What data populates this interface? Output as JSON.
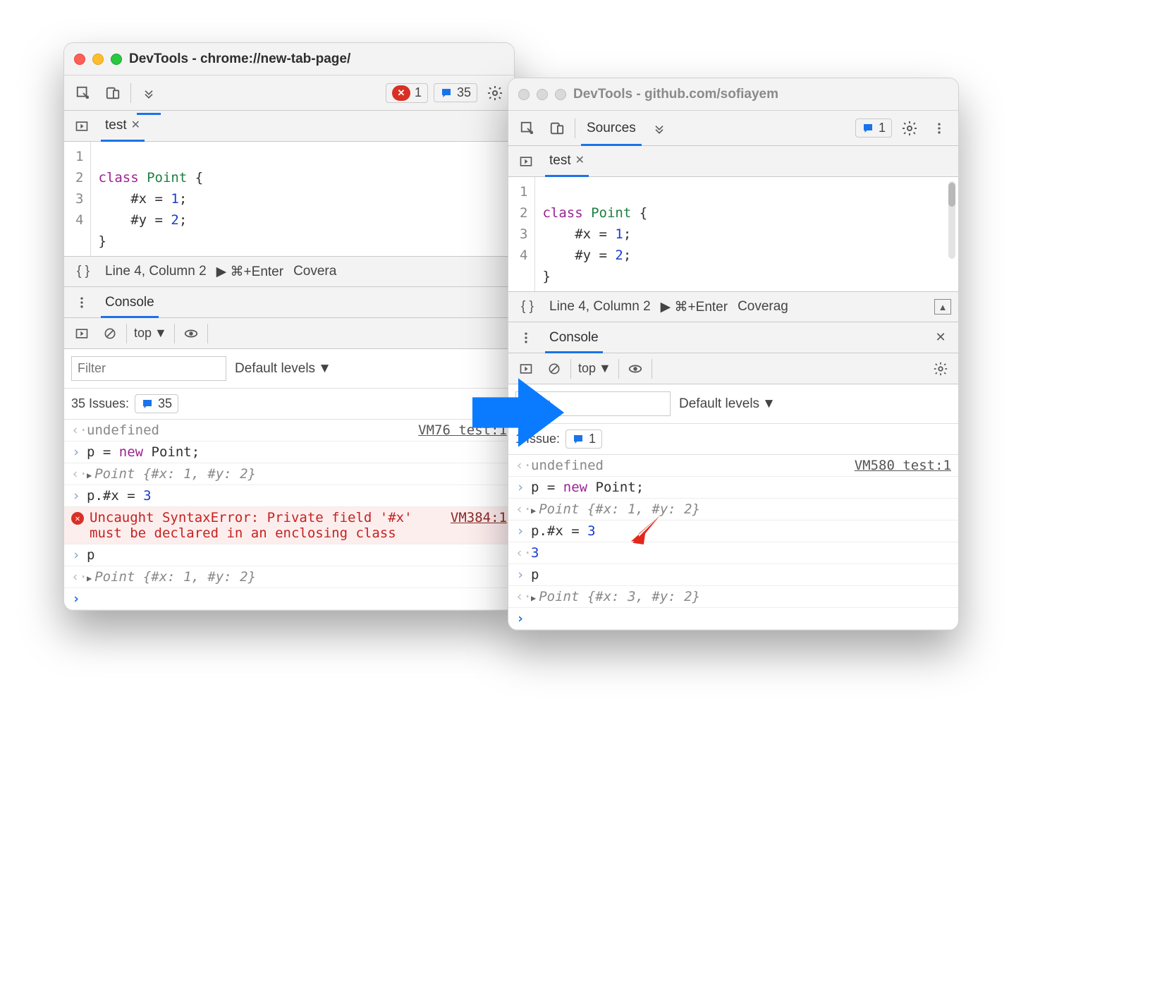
{
  "win1": {
    "title": "DevTools - chrome://new-tab-page/",
    "errors": "1",
    "issues": "35",
    "file_tab": "test",
    "code_lines": [
      "1",
      "2",
      "3",
      "4"
    ],
    "status_line": "Line 4, Column 2",
    "status_run": "⌘+Enter",
    "status_cov": "Covera",
    "drawer_tab": "Console",
    "context": "top",
    "filter_ph": "Filter",
    "levels": "Default levels",
    "issues_row_label": "35 Issues:",
    "issues_row_count": "35",
    "log": {
      "undef": "undefined",
      "undef_src": "VM76 test:1",
      "p_assign_pre": "p = ",
      "p_assign_kw": "new",
      "p_assign_post": " Point;",
      "p_obj": "Point {#x: 1, #y: 2}",
      "p_set": "p.#x = ",
      "p_set_val": "3",
      "err": "Uncaught SyntaxError: Private field '#x' must be declared in an enclosing class",
      "err_src": "VM384:1",
      "p_only": "p",
      "p_obj2": "Point {#x: 1, #y: 2}"
    }
  },
  "win2": {
    "title": "DevTools - github.com/sofiayem",
    "sources_tab": "Sources",
    "issues": "1",
    "file_tab": "test",
    "code_lines": [
      "1",
      "2",
      "3",
      "4"
    ],
    "status_line": "Line 4, Column 2",
    "status_run": "⌘+Enter",
    "status_cov": "Coverag",
    "drawer_tab": "Console",
    "context": "top",
    "filter_ph": "Filter",
    "levels": "Default levels",
    "issues_row_label": "1 Issue:",
    "issues_row_count": "1",
    "log": {
      "undef": "undefined",
      "undef_src": "VM580 test:1",
      "p_assign_pre": "p = ",
      "p_assign_kw": "new",
      "p_assign_post": " Point;",
      "p_obj": "Point {#x: 1, #y: 2}",
      "p_set": "p.#x = ",
      "p_set_val": "3",
      "three": "3",
      "p_only": "p",
      "p_obj2": "Point {#x: 3, #y: 2}"
    }
  },
  "code": {
    "l1a": "class",
    "l1b": " Point",
    "l1c": " {",
    "l2": "    #x = 1;",
    "l3": "    #y = 2;",
    "l4": "}"
  }
}
